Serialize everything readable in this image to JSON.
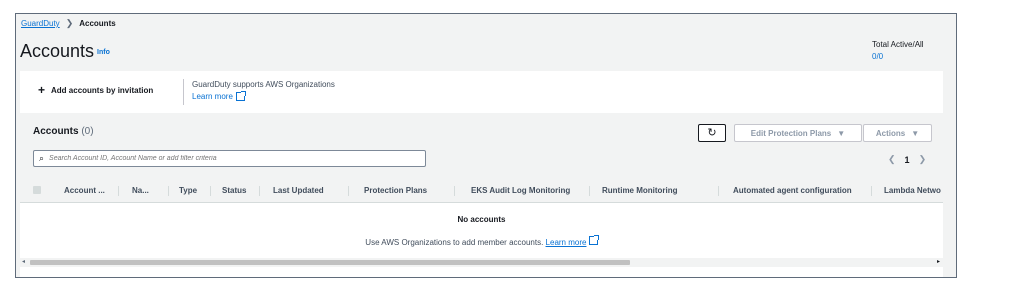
{
  "breadcrumb": {
    "root": "GuardDuty",
    "current": "Accounts"
  },
  "page": {
    "title": "Accounts",
    "info": "Info"
  },
  "total": {
    "label": "Total Active/All",
    "value": "0/0"
  },
  "banner": {
    "add_label": "Add accounts by invitation",
    "org_text": "GuardDuty supports AWS Organizations",
    "learn_more": "Learn more"
  },
  "accounts": {
    "title": "Accounts",
    "count": "(0)",
    "edit_label": "Edit Protection Plans",
    "actions_label": "Actions",
    "search_placeholder": "Search Account ID, Account Name or add filter criteria",
    "page": "1"
  },
  "table": {
    "columns": [
      "Account ...",
      "Na...",
      "Type",
      "Status",
      "Last Updated",
      "Protection Plans",
      "EKS Audit Log Monitoring",
      "Runtime Monitoring",
      "Automated agent configuration",
      "Lambda Netwo"
    ],
    "empty_title": "No accounts",
    "empty_text": "Use AWS Organizations to add member accounts.",
    "empty_link": "Learn more"
  },
  "icons": {
    "search": "search-icon",
    "refresh": "refresh-icon",
    "external": "external-link-icon"
  },
  "colors": {
    "link": "#0972d3",
    "text": "#16191f",
    "background": "#f2f3f3"
  }
}
